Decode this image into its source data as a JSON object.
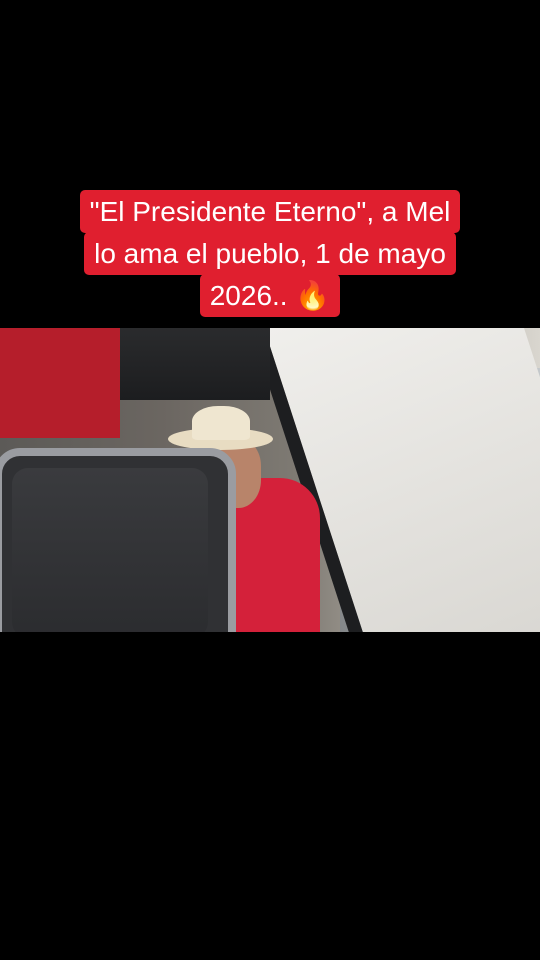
{
  "caption": {
    "lines": [
      "\"El Presidente Eterno\", a Mel",
      "lo ama el pueblo, 1 de mayo",
      "2026.."
    ],
    "emoji": "🔥",
    "background_color": "#e01f2f",
    "text_color": "#ffffff"
  },
  "video": {
    "description_icon": "video-frame"
  }
}
